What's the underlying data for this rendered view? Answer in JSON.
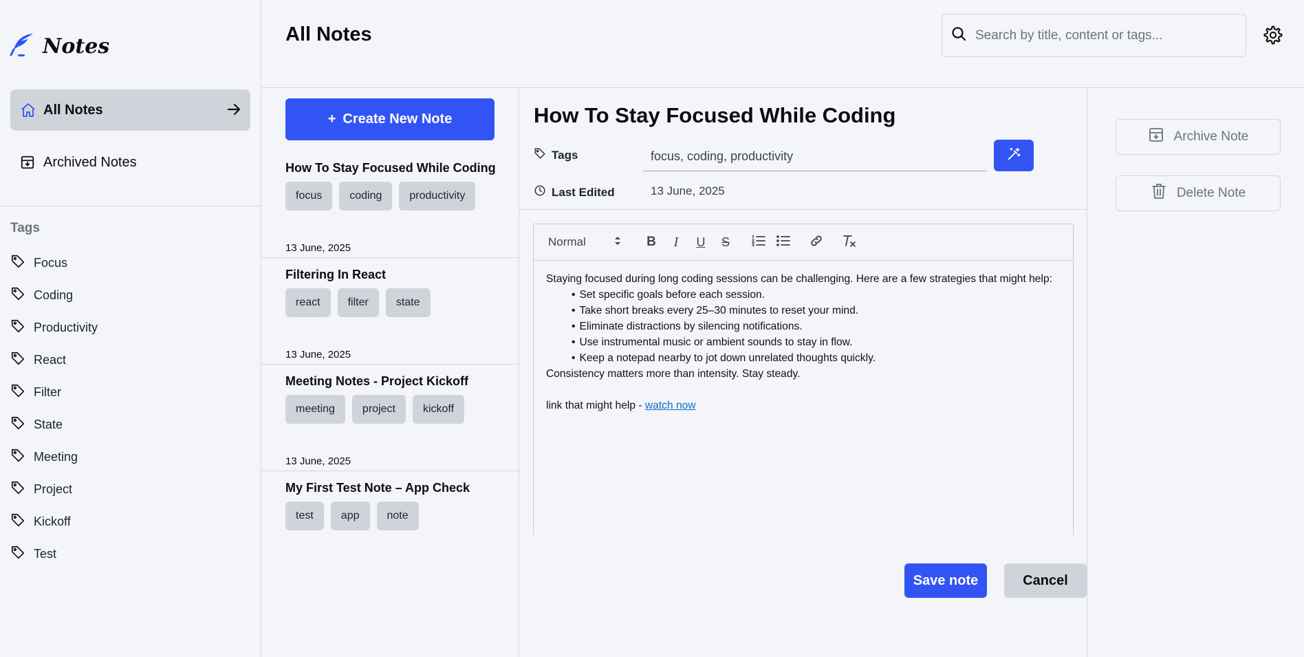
{
  "app": {
    "name": "Notes"
  },
  "sidebar": {
    "nav": [
      {
        "label": "All Notes",
        "active": true
      },
      {
        "label": "Archived Notes",
        "active": false
      }
    ],
    "tags_heading": "Tags",
    "tags": [
      "Focus",
      "Coding",
      "Productivity",
      "React",
      "Filter",
      "State",
      "Meeting",
      "Project",
      "Kickoff",
      "Test"
    ]
  },
  "header": {
    "title": "All Notes",
    "search_placeholder": "Search by title, content or tags..."
  },
  "notes_list": {
    "create_label": "Create New Note",
    "notes": [
      {
        "title": "How To Stay Focused While Coding",
        "tags": [
          "focus",
          "coding",
          "productivity"
        ],
        "date": "13 June, 2025"
      },
      {
        "title": "Filtering In React",
        "tags": [
          "react",
          "filter",
          "state"
        ],
        "date": "13 June, 2025"
      },
      {
        "title": "Meeting Notes - Project Kickoff",
        "tags": [
          "meeting",
          "project",
          "kickoff"
        ],
        "date": "13 June, 2025"
      },
      {
        "title": "My First Test Note – App Check",
        "tags": [
          "test",
          "app",
          "note"
        ],
        "date": "13 June, 2025"
      }
    ]
  },
  "editor": {
    "title": "How To Stay Focused While Coding",
    "tags_label": "Tags",
    "tags_value": "focus, coding, productivity",
    "last_edited_label": "Last Edited",
    "last_edited_value": "13 June, 2025",
    "toolbar": {
      "format_select": "Normal"
    },
    "body": {
      "intro": "Staying focused during long coding sessions can be challenging. Here are a few strategies that might help:",
      "bullets": [
        "Set specific goals before each session.",
        "Take short breaks every 25–30 minutes to reset your mind.",
        "Eliminate distractions by silencing notifications.",
        "Use instrumental music or ambient sounds to stay in flow.",
        "Keep a notepad nearby to jot down unrelated thoughts quickly."
      ],
      "closing": "Consistency matters more than intensity. Stay steady.",
      "link_prefix": "link that might help - ",
      "link_text": "watch now"
    },
    "save_label": "Save note",
    "cancel_label": "Cancel"
  },
  "actions": {
    "archive_label": "Archive Note",
    "delete_label": "Delete Note"
  },
  "colors": {
    "accent": "#3354f5",
    "chip_bg": "#d0d4da",
    "page_bg": "#f3f5f8"
  }
}
